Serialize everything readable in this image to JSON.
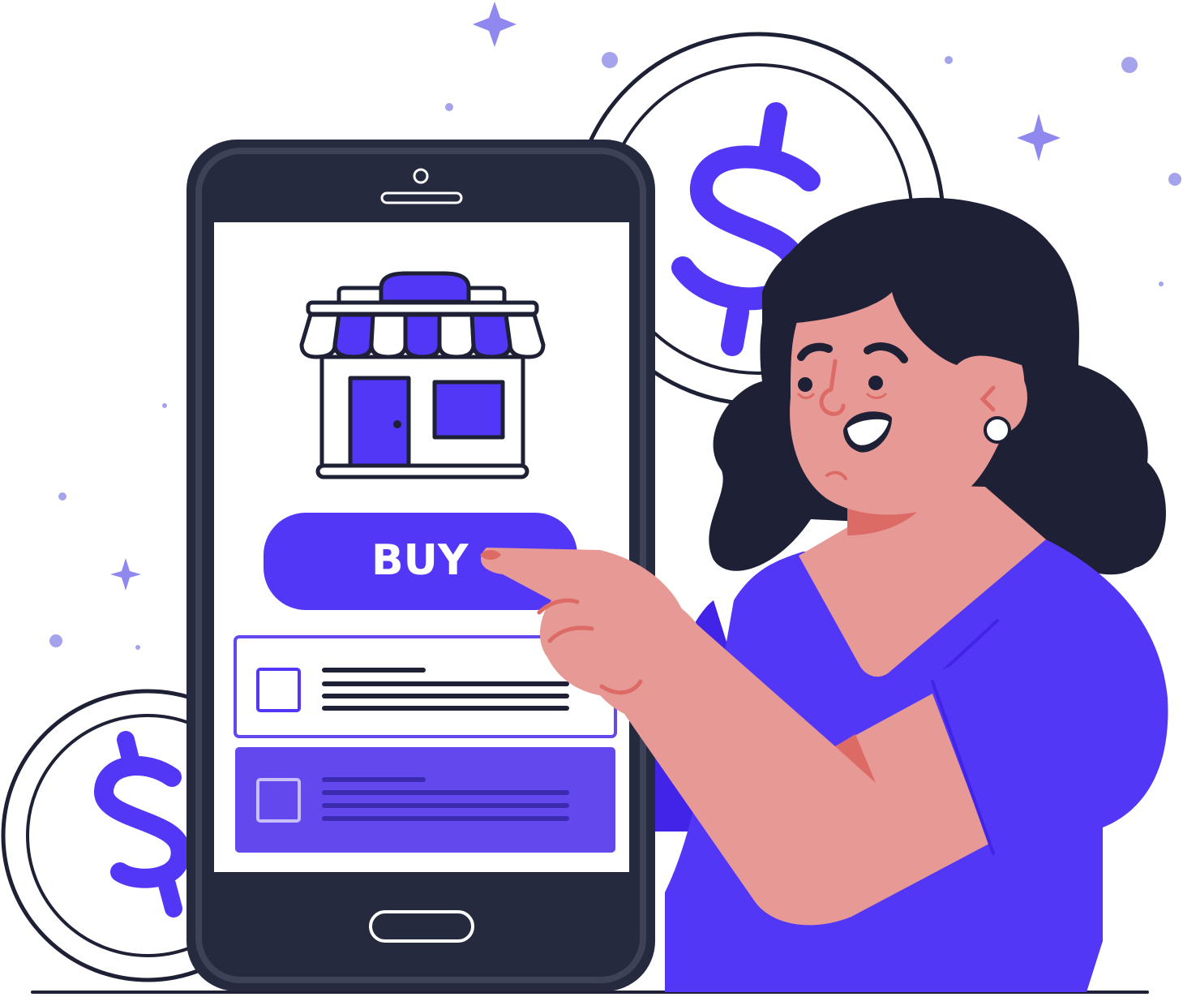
{
  "buy_button": {
    "label": "BUY"
  },
  "colors": {
    "accent": "#5237f7",
    "accent_light": "#6348ee",
    "phone_dark": "#262a3f",
    "outline": "#1e2035",
    "skin": "#e79995",
    "skin_shadow": "#dc6b66",
    "hair": "#1e2035",
    "sparkle": "#8f88ee",
    "dot": "#a5a3eb"
  },
  "icons": {
    "store": "storefront-icon",
    "coin": "dollar-coin-icon",
    "sparkle": "sparkle-icon"
  }
}
